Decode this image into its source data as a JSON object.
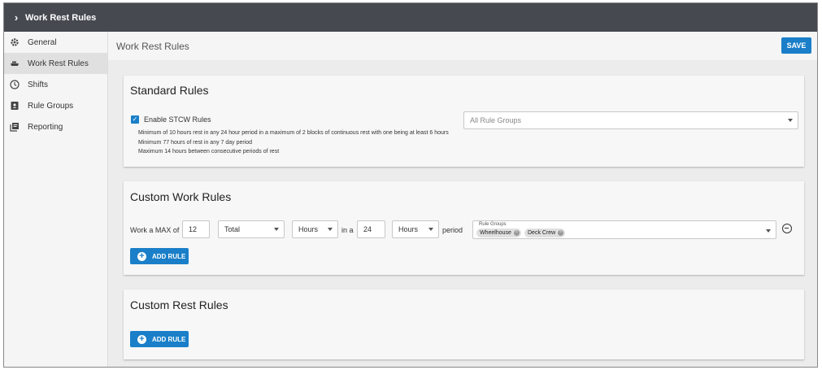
{
  "topbar": {
    "title": "Work Rest Rules",
    "chevron": "›"
  },
  "sidebar": {
    "items": [
      {
        "label": "General",
        "icon": "gear-icon"
      },
      {
        "label": "Work Rest Rules",
        "icon": "ship-icon",
        "active": true
      },
      {
        "label": "Shifts",
        "icon": "clock-icon"
      },
      {
        "label": "Rule Groups",
        "icon": "id-badge-icon"
      },
      {
        "label": "Reporting",
        "icon": "pdf-icon"
      }
    ]
  },
  "header": {
    "title": "Work Rest Rules",
    "save_label": "SAVE"
  },
  "standard": {
    "title": "Standard Rules",
    "checkbox_label": "Enable STCW Rules",
    "checked": true,
    "rules": [
      "Minimum of 10 hours rest in any 24 hour period in a maximum of 2 blocks of continuous rest with one being at least 6 hours",
      "Minimum 77 hours of rest in any 7 day period",
      "Maximum 14 hours between consecutive periods of rest"
    ],
    "groups_placeholder": "All Rule Groups"
  },
  "custom_work": {
    "title": "Custom Work Rules",
    "work_label": "Work a MAX of",
    "max_value": "12",
    "type_value": "Total",
    "unit1": "Hours",
    "in_a_label": "in a",
    "period_value": "24",
    "unit2": "Hours",
    "period_label": "period",
    "groups_label": "Rule Groups",
    "chips": [
      "Wheelhouse",
      "Deck Crew"
    ],
    "add_label": "ADD RULE"
  },
  "custom_rest": {
    "title": "Custom Rest Rules",
    "add_label": "ADD RULE"
  },
  "colors": {
    "accent": "#1a7fc8",
    "topbar": "#464a50"
  }
}
